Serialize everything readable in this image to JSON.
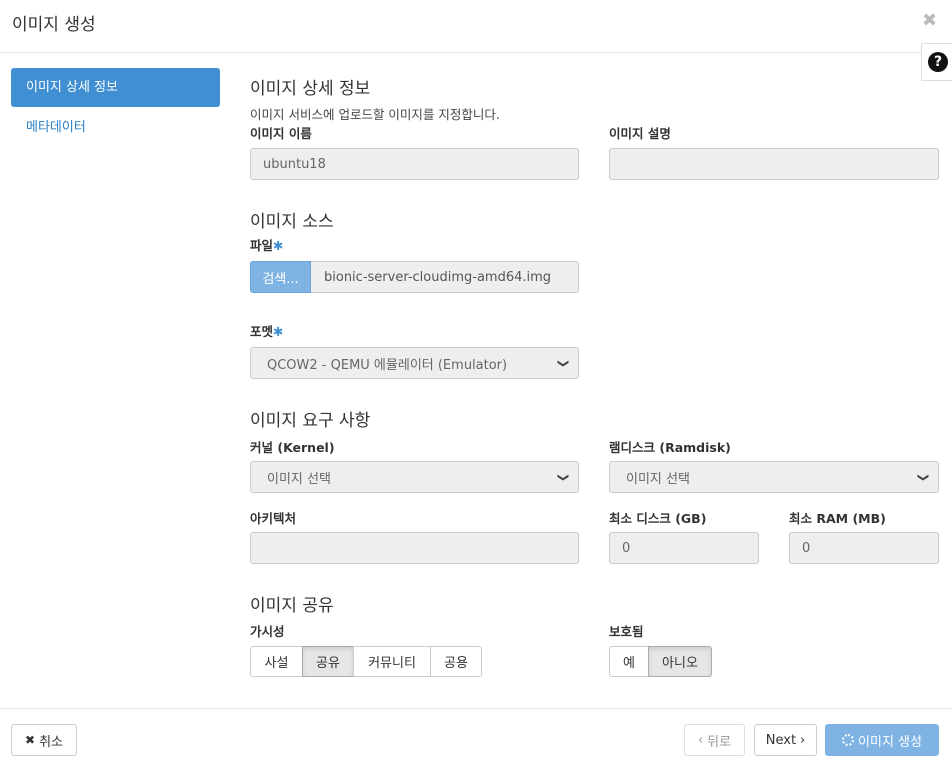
{
  "modal": {
    "title": "이미지 생성",
    "close_icon": "close-icon",
    "help_glyph": "?"
  },
  "sidebar": {
    "items": [
      {
        "label": "이미지 상세 정보",
        "active": true
      },
      {
        "label": "메타데이터",
        "active": false
      }
    ]
  },
  "details": {
    "title": "이미지 상세 정보",
    "help": "이미지 서비스에 업로드할 이미지를 지정합니다.",
    "name_label": "이미지 이름",
    "name_value": "ubuntu18",
    "desc_label": "이미지 설명",
    "desc_value": ""
  },
  "source": {
    "title": "이미지 소스",
    "file_label": "파일",
    "required_mark": "✱",
    "browse_label": "검색...",
    "file_name": "bionic-server-cloudimg-amd64.img",
    "format_label": "포멧",
    "format_value": "QCOW2 - QEMU 에뮬레이터 (Emulator)"
  },
  "requirements": {
    "title": "이미지 요구 사항",
    "kernel_label": "커널 (Kernel)",
    "kernel_value": "이미지 선택",
    "ramdisk_label": "램디스크 (Ramdisk)",
    "ramdisk_value": "이미지 선택",
    "arch_label": "아키텍처",
    "arch_value": "",
    "min_disk_label": "최소 디스크 (GB)",
    "min_disk_value": "0",
    "min_ram_label": "최소 RAM (MB)",
    "min_ram_value": "0"
  },
  "sharing": {
    "title": "이미지 공유",
    "visibility_label": "가시성",
    "visibility_options": [
      "사설",
      "공유",
      "커뮤니티",
      "공용"
    ],
    "visibility_selected": "공유",
    "protected_label": "보호됨",
    "protected_options": [
      "예",
      "아니오"
    ],
    "protected_selected": "아니오"
  },
  "footer": {
    "cancel_label": "취소",
    "back_label": "뒤로",
    "next_label": "Next",
    "create_label": "이미지 생성"
  },
  "colors": {
    "accent": "#3f8fd2",
    "primary_disabled": "#7fb3e3"
  }
}
